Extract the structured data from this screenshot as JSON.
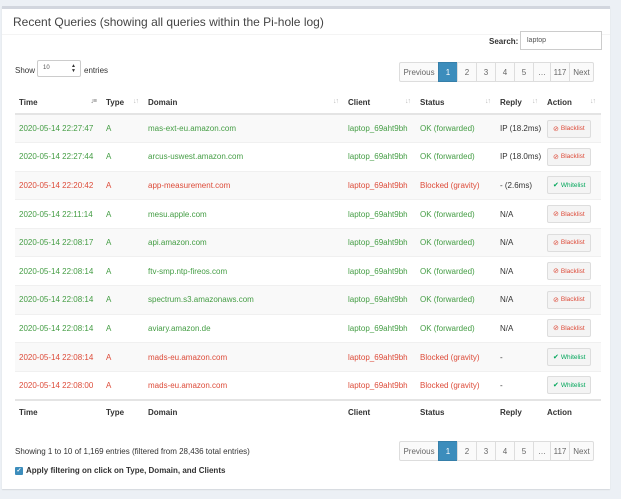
{
  "title": "Recent Queries (showing all queries within the Pi-hole log)",
  "search": {
    "label": "Search:",
    "value": "laptop"
  },
  "length_menu": {
    "show": "Show",
    "value": "10",
    "entries": "entries"
  },
  "pagination": [
    "Previous",
    "1",
    "2",
    "3",
    "4",
    "5",
    "…",
    "117",
    "Next"
  ],
  "pagination_active": "1",
  "columns": [
    "Time",
    "Type",
    "Domain",
    "Client",
    "Status",
    "Reply",
    "Action"
  ],
  "rows": [
    {
      "time": "2020-05-14 22:27:47",
      "type": "A",
      "domain": "mas-ext-eu.amazon.com",
      "client": "laptop_69aht9bh",
      "status": "OK (forwarded)",
      "reply": "IP (18.2ms)",
      "action": "Blacklist",
      "blocked": false
    },
    {
      "time": "2020-05-14 22:27:44",
      "type": "A",
      "domain": "arcus-uswest.amazon.com",
      "client": "laptop_69aht9bh",
      "status": "OK (forwarded)",
      "reply": "IP (18.0ms)",
      "action": "Blacklist",
      "blocked": false
    },
    {
      "time": "2020-05-14 22:20:42",
      "type": "A",
      "domain": "app-measurement.com",
      "client": "laptop_69aht9bh",
      "status": "Blocked (gravity)",
      "reply": "- (2.6ms)",
      "action": "Whitelist",
      "blocked": true
    },
    {
      "time": "2020-05-14 22:11:14",
      "type": "A",
      "domain": "mesu.apple.com",
      "client": "laptop_69aht9bh",
      "status": "OK (forwarded)",
      "reply": "N/A",
      "action": "Blacklist",
      "blocked": false
    },
    {
      "time": "2020-05-14 22:08:17",
      "type": "A",
      "domain": "api.amazon.com",
      "client": "laptop_69aht9bh",
      "status": "OK (forwarded)",
      "reply": "N/A",
      "action": "Blacklist",
      "blocked": false
    },
    {
      "time": "2020-05-14 22:08:14",
      "type": "A",
      "domain": "ftv-smp.ntp-fireos.com",
      "client": "laptop_69aht9bh",
      "status": "OK (forwarded)",
      "reply": "N/A",
      "action": "Blacklist",
      "blocked": false
    },
    {
      "time": "2020-05-14 22:08:14",
      "type": "A",
      "domain": "spectrum.s3.amazonaws.com",
      "client": "laptop_69aht9bh",
      "status": "OK (forwarded)",
      "reply": "N/A",
      "action": "Blacklist",
      "blocked": false
    },
    {
      "time": "2020-05-14 22:08:14",
      "type": "A",
      "domain": "aviary.amazon.de",
      "client": "laptop_69aht9bh",
      "status": "OK (forwarded)",
      "reply": "N/A",
      "action": "Blacklist",
      "blocked": false
    },
    {
      "time": "2020-05-14 22:08:14",
      "type": "A",
      "domain": "mads-eu.amazon.com",
      "client": "laptop_69aht9bh",
      "status": "Blocked (gravity)",
      "reply": "-",
      "action": "Whitelist",
      "blocked": true
    },
    {
      "time": "2020-05-14 22:08:00",
      "type": "A",
      "domain": "mads-eu.amazon.com",
      "client": "laptop_69aht9bh",
      "status": "Blocked (gravity)",
      "reply": "-",
      "action": "Whitelist",
      "blocked": true
    }
  ],
  "info": "Showing 1 to 10 of 1,169 entries (filtered from 28,436 total entries)",
  "apply_filter_label": "Apply filtering on click on Type, Domain, and Clients",
  "colors": {
    "ok": "#449d44",
    "blocked": "#dd4b39",
    "active_page": "#3c8dbc"
  },
  "icons": {
    "blacklist": "ban-icon",
    "whitelist": "check-icon",
    "checkbox": "checkbox-checked-icon"
  }
}
